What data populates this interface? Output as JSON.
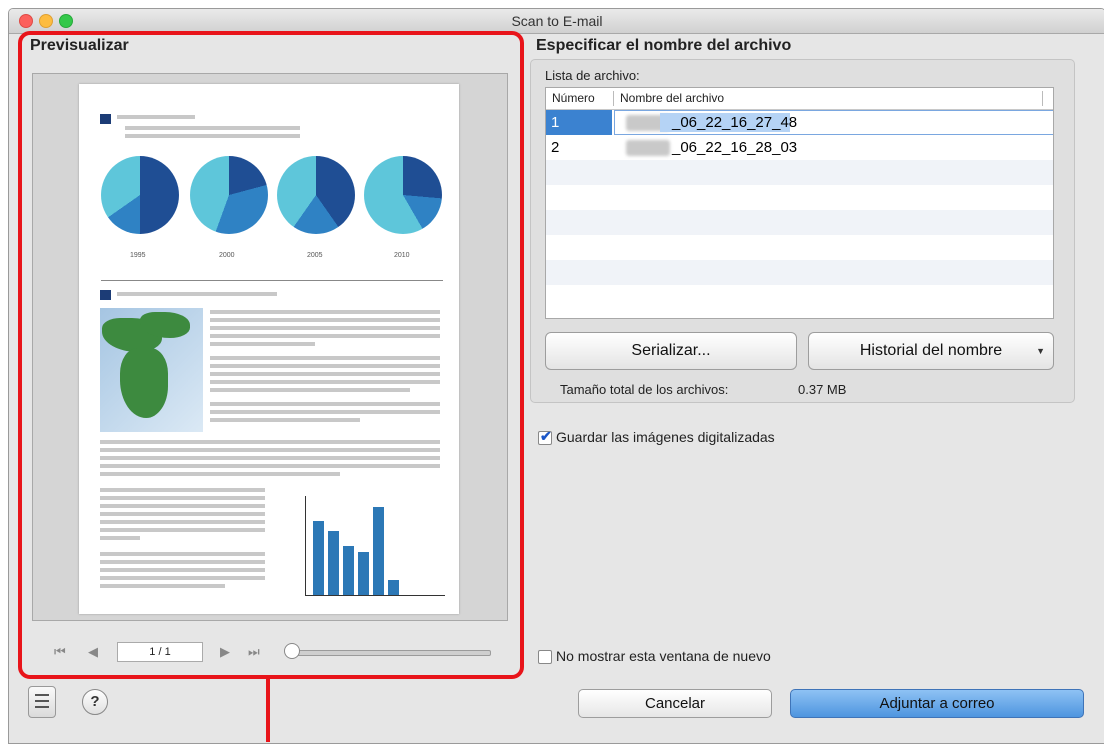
{
  "window": {
    "title": "Scan to E-mail"
  },
  "preview": {
    "title": "Previsualizar",
    "page_indicator": "1 / 1",
    "zoom_level": 0,
    "document": {
      "pie_years": [
        "1995",
        "2000",
        "2005",
        "2010"
      ],
      "bar_chart_values": [
        75,
        65,
        50,
        44,
        90,
        15
      ],
      "bar_chart_ylim": [
        0,
        100
      ]
    }
  },
  "file_section": {
    "title": "Especificar el nombre del archivo",
    "list_label": "Lista de archivo:",
    "columns": [
      "Número",
      "Nombre del archivo"
    ],
    "rows": [
      {
        "number": "1",
        "name": "_06_22_16_27_48",
        "selected": true
      },
      {
        "number": "2",
        "name": "_06_22_16_28_03",
        "selected": false
      }
    ],
    "serialize_button": "Serializar...",
    "name_history_button": "Historial del nombre",
    "dropdown_arrow": "▼",
    "total_size_label": "Tamaño total de los archivos:",
    "total_size_value": "0.37 MB"
  },
  "save_images": {
    "label": "Guardar las imágenes digitalizadas",
    "checked": true
  },
  "dont_show": {
    "label": "No mostrar esta ventana de nuevo",
    "checked": false
  },
  "buttons": {
    "cancel": "Cancelar",
    "attach": "Adjuntar a correo",
    "help": "?"
  },
  "icons": {
    "first_page": "first-page-icon",
    "prev_page": "previous-page-icon",
    "next_page": "next-page-icon",
    "last_page": "last-page-icon",
    "list_view": "list-view-icon",
    "help": "help-icon"
  },
  "colors": {
    "annotation_frame": "#e8141a",
    "selection": "#3b82d0",
    "primary_button": "#4e95df"
  }
}
